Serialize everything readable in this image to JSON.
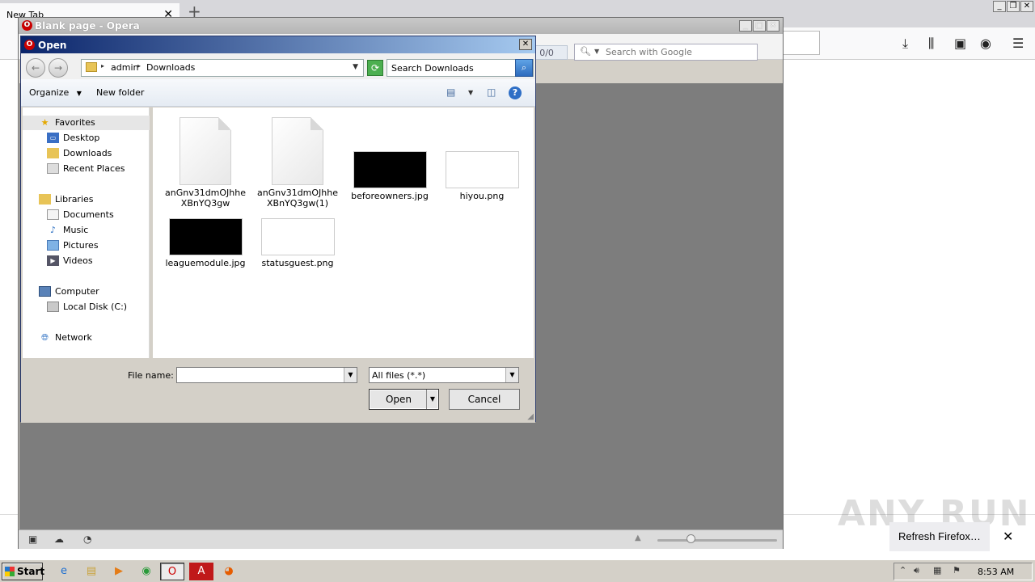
{
  "firefox": {
    "tab_title": "New Tab",
    "tab_close": "✕",
    "new_tab": "+",
    "refresh_button": "Refresh Firefox…",
    "notification_close": "✕",
    "watermark": "ANY RUN",
    "toolbar_icons": [
      "download-icon",
      "library-icon",
      "reader-icon",
      "account-icon",
      "menu-icon"
    ]
  },
  "opera": {
    "window_title": "Blank page - Opera",
    "counter_partial": "nts:  0/0",
    "search_placeholder": "Search with Google"
  },
  "dialog": {
    "title": "Open",
    "close": "✕",
    "breadcrumb": [
      "admin",
      "Downloads"
    ],
    "search_placeholder": "Search Downloads",
    "organize_label": "Organize",
    "new_folder_label": "New folder",
    "nav": {
      "favorites": {
        "label": "Favorites",
        "items": [
          "Desktop",
          "Downloads",
          "Recent Places"
        ]
      },
      "libraries": {
        "label": "Libraries",
        "items": [
          "Documents",
          "Music",
          "Pictures",
          "Videos"
        ]
      },
      "computer": {
        "label": "Computer",
        "items": [
          "Local Disk (C:)"
        ]
      },
      "network": {
        "label": "Network"
      }
    },
    "files": [
      {
        "name": "anGnv31dmOJhheXBnYQ3gw",
        "type": "doc"
      },
      {
        "name": "anGnv31dmOJhheXBnYQ3gw(1)",
        "type": "doc"
      },
      {
        "name": "beforeowners.jpg",
        "type": "image-dark"
      },
      {
        "name": "hiyou.png",
        "type": "image-light"
      },
      {
        "name": "leaguemodule.jpg",
        "type": "image-dark"
      },
      {
        "name": "statusguest.png",
        "type": "image-light"
      }
    ],
    "file_name_label": "File name:",
    "file_name_value": "",
    "filter_value": "All files (*.*)",
    "open_label": "Open",
    "cancel_label": "Cancel"
  },
  "taskbar": {
    "start_label": "Start",
    "clock": "8:53 AM",
    "apps": [
      "ie-icon",
      "explorer-icon",
      "media-player-icon",
      "chrome-icon",
      "opera-icon",
      "acrobat-icon",
      "firefox-icon"
    ]
  }
}
